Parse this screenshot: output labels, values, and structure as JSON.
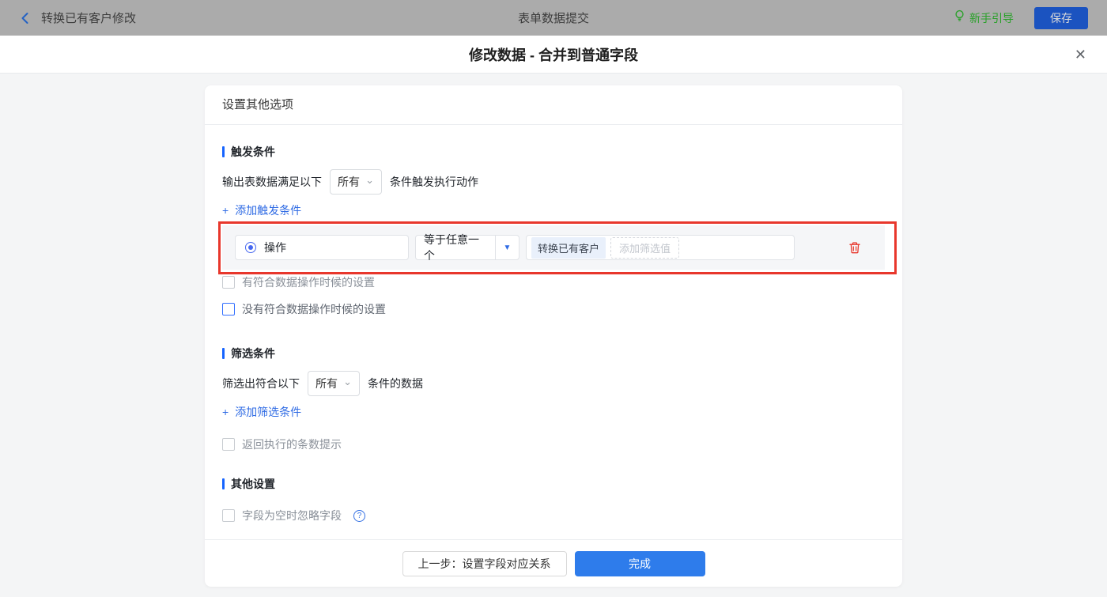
{
  "topbar": {
    "back_label": "转换已有客户修改",
    "title": "表单数据提交",
    "guide_label": "新手引导",
    "save_label": "保存"
  },
  "dialog": {
    "title": "修改数据 - 合并到普通字段"
  },
  "panel": {
    "header": "设置其他选项",
    "trigger_section": {
      "title": "触发条件",
      "sentence_prefix": "输出表数据满足以下",
      "match_value": "所有",
      "sentence_suffix": "条件触发执行动作",
      "add_label": "添加触发条件",
      "condition_row": {
        "field": "操作",
        "operator": "等于任意一个",
        "value_tag": "转换已有客户",
        "value_placeholder": "添加筛选值"
      },
      "checkbox_has_match": "有符合数据操作时候的设置",
      "checkbox_no_match": "没有符合数据操作时候的设置"
    },
    "filter_section": {
      "title": "筛选条件",
      "sentence_prefix": "筛选出符合以下",
      "match_value": "所有",
      "sentence_suffix": "条件的数据",
      "add_label": "添加筛选条件",
      "checkbox_count_tip": "返回执行的条数提示"
    },
    "other_section": {
      "title": "其他设置",
      "checkbox_ignore_empty": "字段为空时忽略字段"
    },
    "footer": {
      "prev_label": "上一步：设置字段对应关系",
      "done_label": "完成"
    }
  },
  "icons": {
    "plus": "+",
    "chevron_down": "⌄",
    "caret_down": "▼",
    "close": "✕",
    "help": "?"
  },
  "colors": {
    "accent_blue": "#2f6be4",
    "highlight_red": "#e8372c",
    "guide_green": "#2aa12a",
    "primary_button": "#2e7ceb",
    "section_bar": "#1664ff"
  }
}
